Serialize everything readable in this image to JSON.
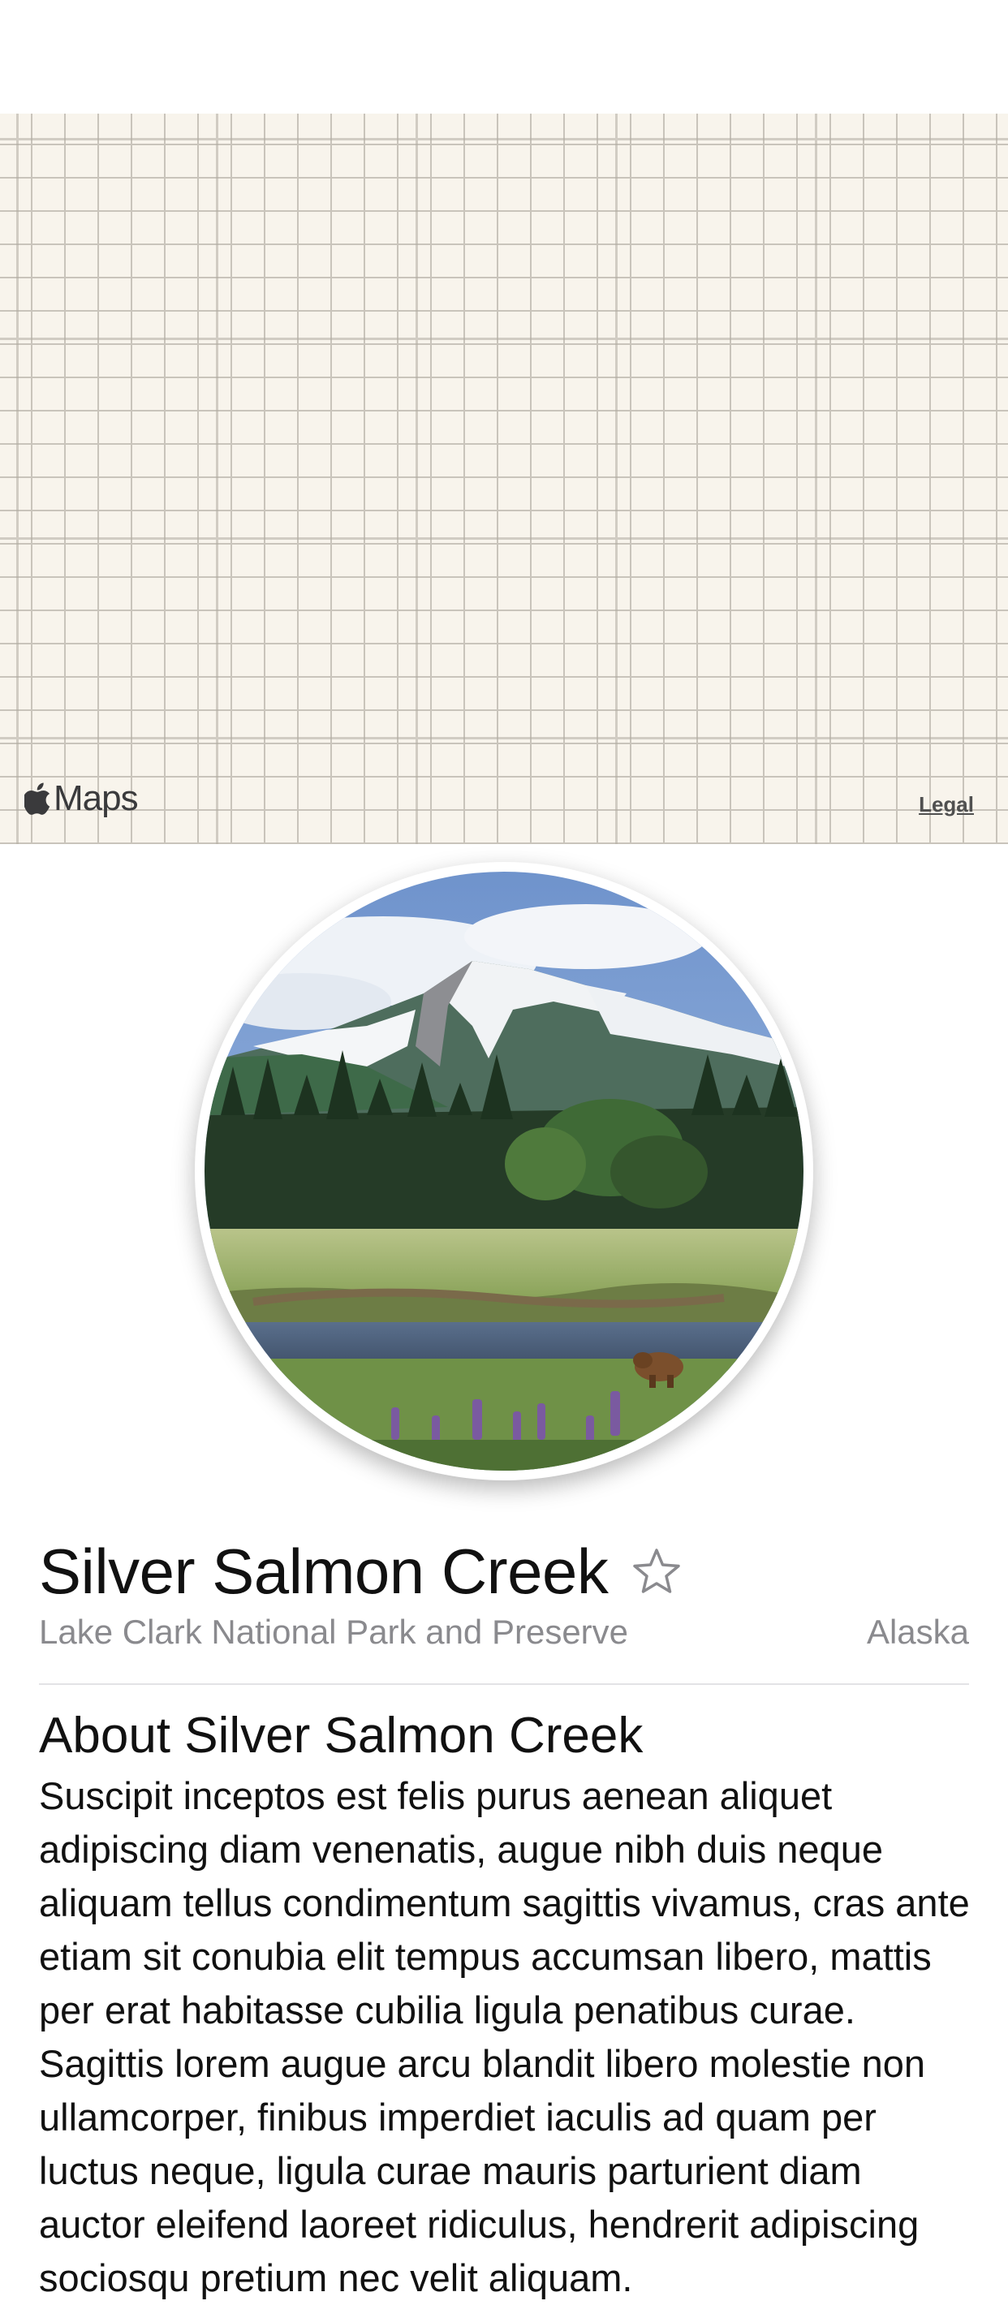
{
  "map": {
    "provider_label": "Maps",
    "legal_label": "Legal"
  },
  "place": {
    "title": "Silver Salmon Creek",
    "park": "Lake Clark National Park and Preserve",
    "state": "Alaska",
    "favorite_icon": "star-outline-icon"
  },
  "about": {
    "heading": "About Silver Salmon Creek",
    "body": "Suscipit inceptos est felis purus aenean aliquet adipiscing diam venenatis, augue nibh duis neque aliquam tellus condimentum sagittis vivamus, cras ante etiam sit conubia elit tempus accumsan libero, mattis per erat habitasse cubilia ligula penatibus curae. Sagittis lorem augue arcu blandit libero molestie non ullamcorper, finibus imperdiet iaculis ad quam per luctus neque, ligula curae mauris parturient diam auctor eleifend laoreet ridiculus, hendrerit adipiscing sociosqu pretium nec velit aliquam."
  },
  "colors": {
    "map_background": "#f8f4ec",
    "map_grid": "#c9c4bb",
    "secondary_text": "#8a8a8e",
    "divider": "#e3e3e6"
  }
}
